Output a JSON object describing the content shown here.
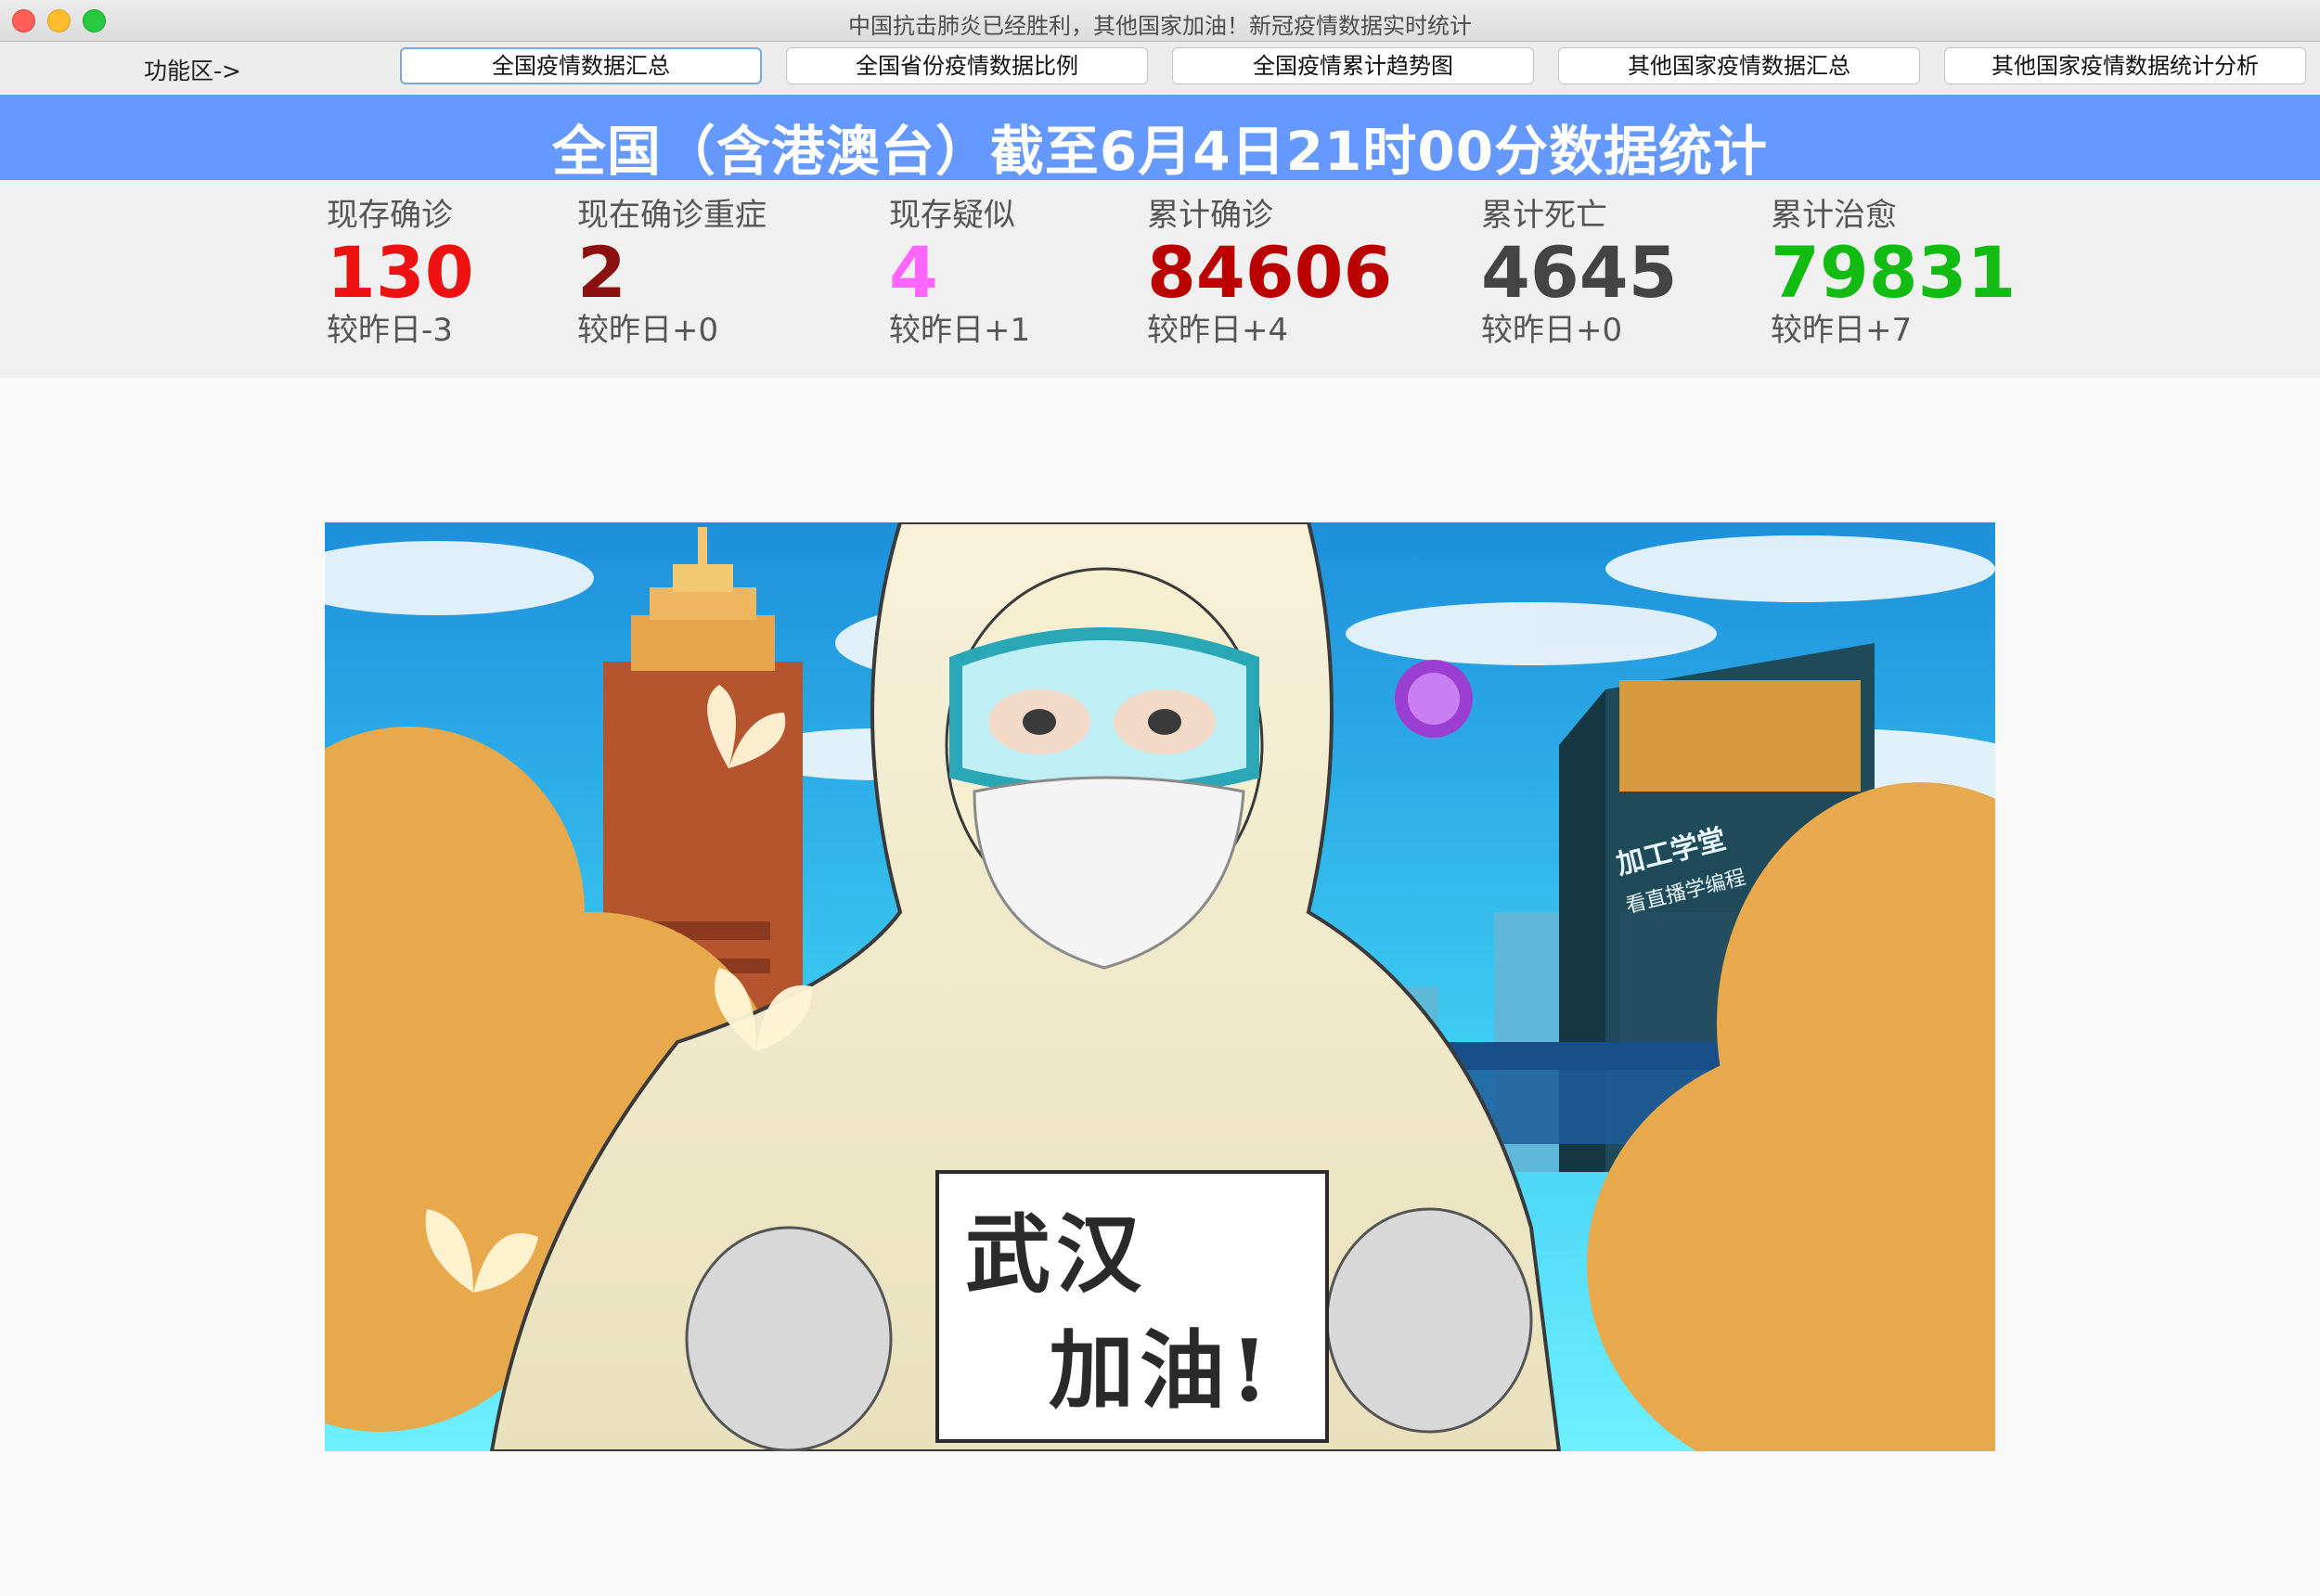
{
  "window": {
    "title": "中国抗击肺炎已经胜利，其他国家加油！新冠疫情数据实时统计"
  },
  "toolbar": {
    "label": "功能区->",
    "buttons": [
      {
        "label": "全国疫情数据汇总",
        "active": true
      },
      {
        "label": "全国省份疫情数据比例",
        "active": false
      },
      {
        "label": "全国疫情累计趋势图",
        "active": false
      },
      {
        "label": "其他国家疫情数据汇总",
        "active": false
      },
      {
        "label": "其他国家疫情数据统计分析",
        "active": false
      }
    ]
  },
  "banner": {
    "text": "全国（含港澳台）截至6月4日21时00分数据统计",
    "color": "#6699ff"
  },
  "stats": [
    {
      "label": "现存确诊",
      "value": "130",
      "delta": "较昨日-3",
      "color": "#ee1111"
    },
    {
      "label": "现在确诊重症",
      "value": "2",
      "delta": "较昨日+0",
      "color": "#8b1111"
    },
    {
      "label": "现存疑似",
      "value": "4",
      "delta": "较昨日+1",
      "color": "#ff66ff"
    },
    {
      "label": "累计确诊",
      "value": "84606",
      "delta": "较昨日+4",
      "color": "#bb0000"
    },
    {
      "label": "累计死亡",
      "value": "4645",
      "delta": "较昨日+0",
      "color": "#444444"
    },
    {
      "label": "累计治愈",
      "value": "79831",
      "delta": "较昨日+7",
      "color": "#11bb11"
    }
  ],
  "poster": {
    "sign_line_1": "武汉",
    "sign_line_2": "加油!",
    "building_sign": "加工学堂",
    "building_sub": "看直播学编程"
  }
}
